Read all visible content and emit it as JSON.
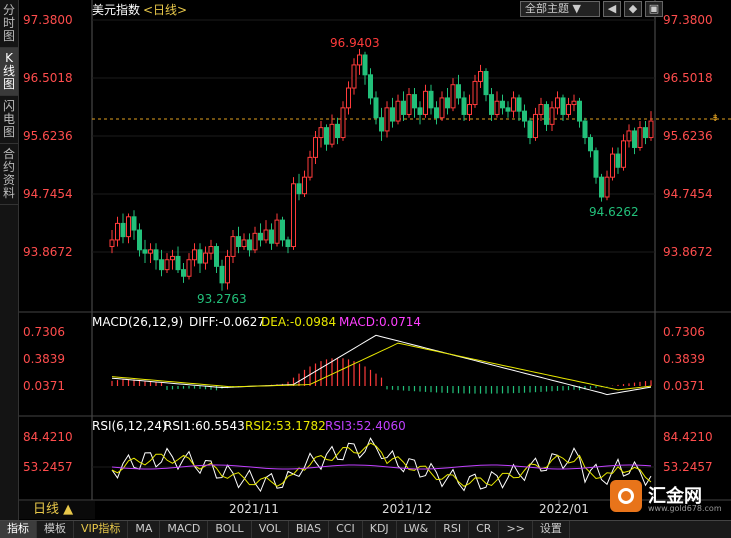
{
  "sidebar": [
    {
      "label": "分时图",
      "active": false
    },
    {
      "label": "K线图",
      "active": true
    },
    {
      "label": "闪电图",
      "active": false
    },
    {
      "label": "合约资料",
      "active": false
    }
  ],
  "header": {
    "symbol": "美元指数",
    "period_tag": "<日线>"
  },
  "toolbar": {
    "theme_select": "全部主题",
    "tool1": "◀",
    "tool2": "◆",
    "tool3": "▣"
  },
  "price_axis": [
    "97.3800",
    "96.5018",
    "95.6236",
    "94.7454",
    "93.8672"
  ],
  "annotations": {
    "high": "96.9403",
    "low_left": "93.2763",
    "low_right": "94.6262"
  },
  "macd": {
    "title": "MACD(26,12,9)",
    "diff": "DIFF:-0.0627",
    "dea": "DEA:-0.0984",
    "macd": "MACD:0.0714",
    "axis": [
      "0.7306",
      "0.3839",
      "0.0371"
    ]
  },
  "rsi": {
    "title": "RSI(6,12,24)",
    "rsi1": "RSI1:60.5543",
    "rsi2": "RSI2:53.1782",
    "rsi3": "RSI3:52.4060",
    "axis": [
      "84.4210",
      "53.2457"
    ]
  },
  "x_labels": [
    "2021/11",
    "2021/12",
    "2022/01"
  ],
  "period_button": "日线 ▲",
  "bottom_tabs": [
    "指标",
    "模板",
    "VIP指标",
    "MA",
    "MACD",
    "BOLL",
    "VOL",
    "BIAS",
    "CCI",
    "KDJ",
    "LW&",
    "RSI",
    "CR",
    ">>",
    "设置"
  ],
  "logo": {
    "name": "汇金网",
    "url": "www.gold678.com"
  },
  "colors": {
    "up": "#ff3b3b",
    "down": "#22c07a",
    "diff": "#ffffff",
    "dea": "#e8e800",
    "macd_label": "#ff40ff",
    "rsi3": "#c040ff",
    "axis_text": "#ff4d4d",
    "label_gold": "#e8c84a"
  }
}
